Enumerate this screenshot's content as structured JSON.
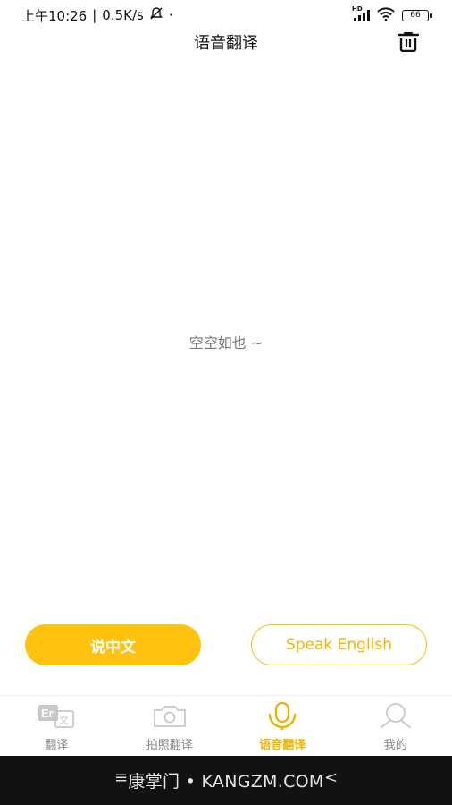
{
  "status_bar": {
    "time": "上午10:26",
    "separator": "|",
    "net_speed": "0.5K/s",
    "dot": "·",
    "battery": "66",
    "hd": "HD"
  },
  "header": {
    "title": "语音翻译"
  },
  "main": {
    "empty_text": "空空如也 ~"
  },
  "actions": {
    "speak_chinese": "说中文",
    "speak_english": "Speak English"
  },
  "tabs": [
    {
      "label": "翻译",
      "icon": "translate-icon",
      "active": false
    },
    {
      "label": "拍照翻译",
      "icon": "camera-icon",
      "active": false
    },
    {
      "label": "语音翻译",
      "icon": "microphone-icon",
      "active": true
    },
    {
      "label": "我的",
      "icon": "profile-icon",
      "active": false
    }
  ],
  "tab_icon_text": {
    "en": "En",
    "wen": "文"
  },
  "system_nav": {
    "watermark": "康掌门 • KANGZM.COM",
    "menu": "≡",
    "back": "<"
  },
  "colors": {
    "accent": "#ffc20e",
    "accent_text": "#f0b400",
    "inactive": "#888888"
  }
}
